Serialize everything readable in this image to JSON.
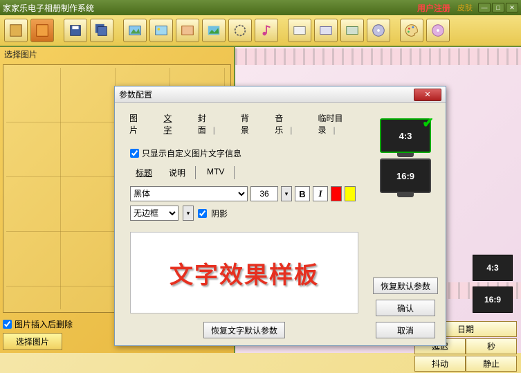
{
  "titlebar": {
    "app_title": "家家乐电子相册制作系统",
    "register": "用户注册",
    "skin": "皮肤"
  },
  "left_panel": {
    "title": "选择图片",
    "delete_after_insert": "图片插入后删除",
    "select_btn": "选择图片"
  },
  "right_panel": {
    "ratio_43": "4:3",
    "ratio_169": "16:9",
    "ctrl": {
      "date": "日期",
      "delay": "延迟",
      "sec": "秒",
      "shake": "抖动",
      "stop": "静止"
    }
  },
  "dialog": {
    "title": "参数配置",
    "tabs": [
      "图片",
      "文字",
      "封面",
      "背景",
      "音乐",
      "临时目录"
    ],
    "active_tab": 1,
    "only_custom": "只显示自定义图片文字信息",
    "subtabs": [
      "标题",
      "说明",
      "MTV"
    ],
    "active_subtab": 0,
    "font_name": "黑体",
    "font_size": "36",
    "bold": "B",
    "italic": "I",
    "border_sel": "无边框",
    "shadow": "阴影",
    "preview_text": "文字效果样板",
    "restore_text_btn": "恢复文字默认参数",
    "restore_btn": "恢复默认参数",
    "ok_btn": "确认",
    "cancel_btn": "取消",
    "ratio_a": "4:3",
    "ratio_b": "16:9"
  }
}
